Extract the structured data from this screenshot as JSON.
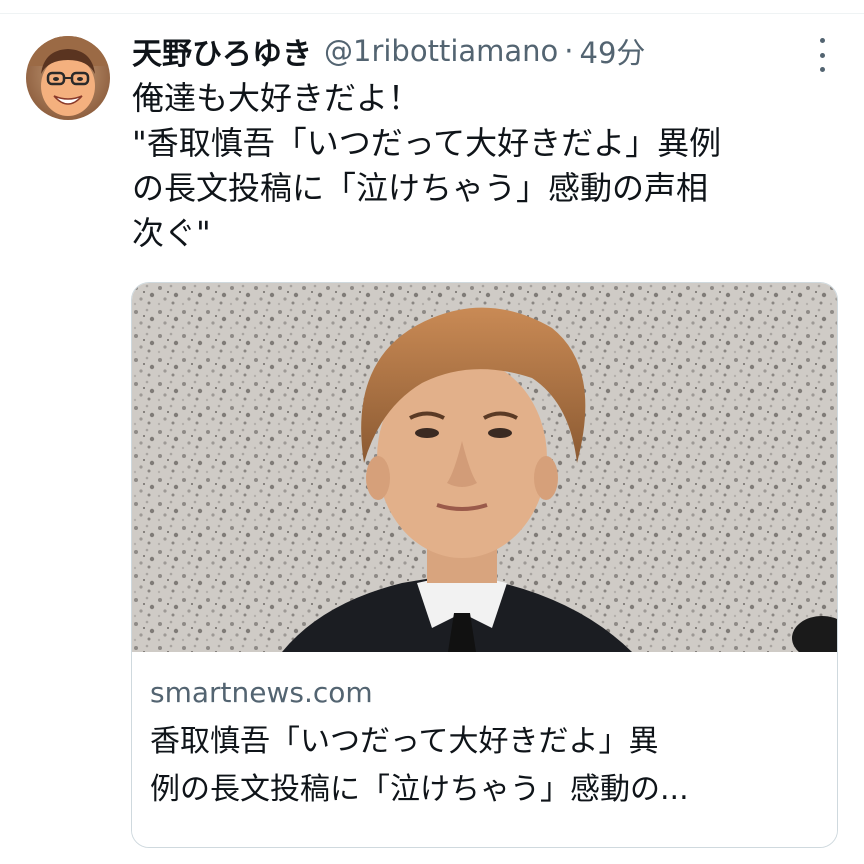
{
  "tweet": {
    "display_name": "天野ひろゆき",
    "handle": "@1ribottiamano",
    "separator": "·",
    "time": "49分",
    "text_lines": [
      "俺達も大好きだよ！",
      "\"香取慎吾「いつだって大好きだよ」異例",
      "の長文投稿に「泣けちゃう」感動の声相",
      "次ぐ\""
    ]
  },
  "card": {
    "domain": "smartnews.com",
    "title_lines": [
      "香取慎吾「いつだって大好きだよ」異",
      "例の長文投稿に「泣けちゃう」感動の..."
    ]
  },
  "icons": {
    "more": "more-vertical-icon"
  },
  "colors": {
    "text_primary": "#0f1419",
    "text_secondary": "#536471",
    "border": "#cfd9de"
  }
}
